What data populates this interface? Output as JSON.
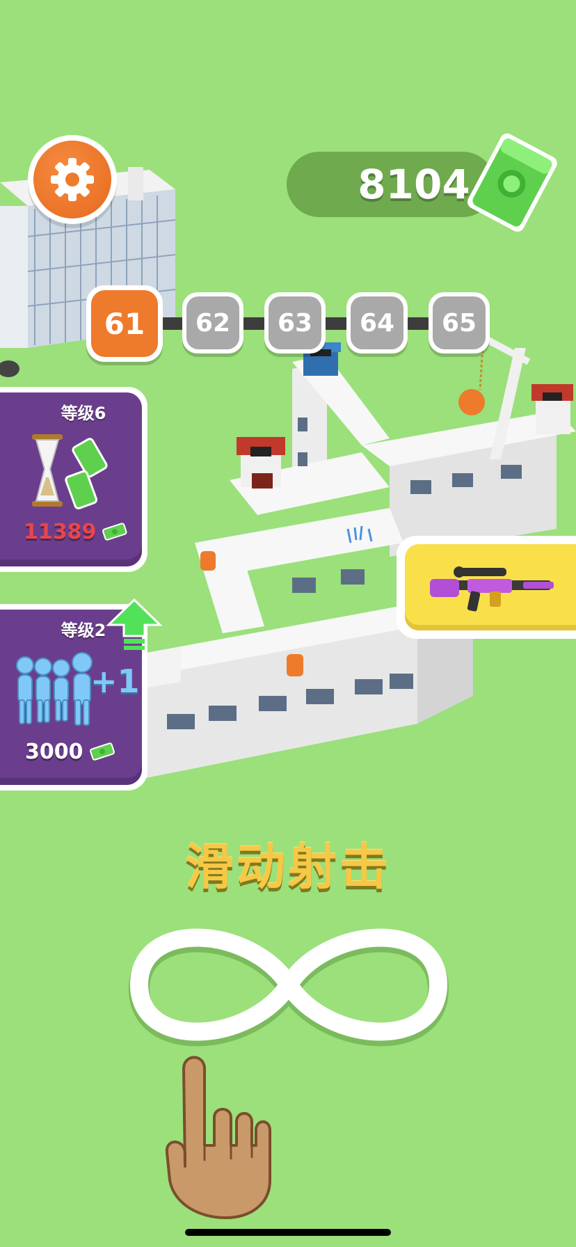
{
  "currency": {
    "amount": "8104",
    "icon": "cash-stack-icon"
  },
  "levels": [
    {
      "label": "61",
      "state": "current"
    },
    {
      "label": "62",
      "state": "locked"
    },
    {
      "label": "63",
      "state": "locked"
    },
    {
      "label": "64",
      "state": "locked"
    },
    {
      "label": "65",
      "state": "locked"
    }
  ],
  "upgrades": {
    "income": {
      "title": "等级6",
      "cost": "11389",
      "icon": "hourglass-money-icon",
      "cost_color": "#e8464a"
    },
    "crowd": {
      "title": "等级2",
      "bonus": "+1",
      "cost": "3000",
      "icon": "stickman-crowd-icon",
      "cost_color": "#ffffff"
    }
  },
  "weapon": {
    "icon": "rifle-icon"
  },
  "tutorial": {
    "instruction": "滑动射击",
    "gesture_icon": "infinity-swipe-icon",
    "hand_icon": "pointing-hand-icon"
  },
  "colors": {
    "background": "#9be07a",
    "accent_orange": "#ee7a2c",
    "card_purple": "#6b3e8d",
    "weapon_yellow": "#f9e04a",
    "instruction_yellow": "#f6c846"
  }
}
